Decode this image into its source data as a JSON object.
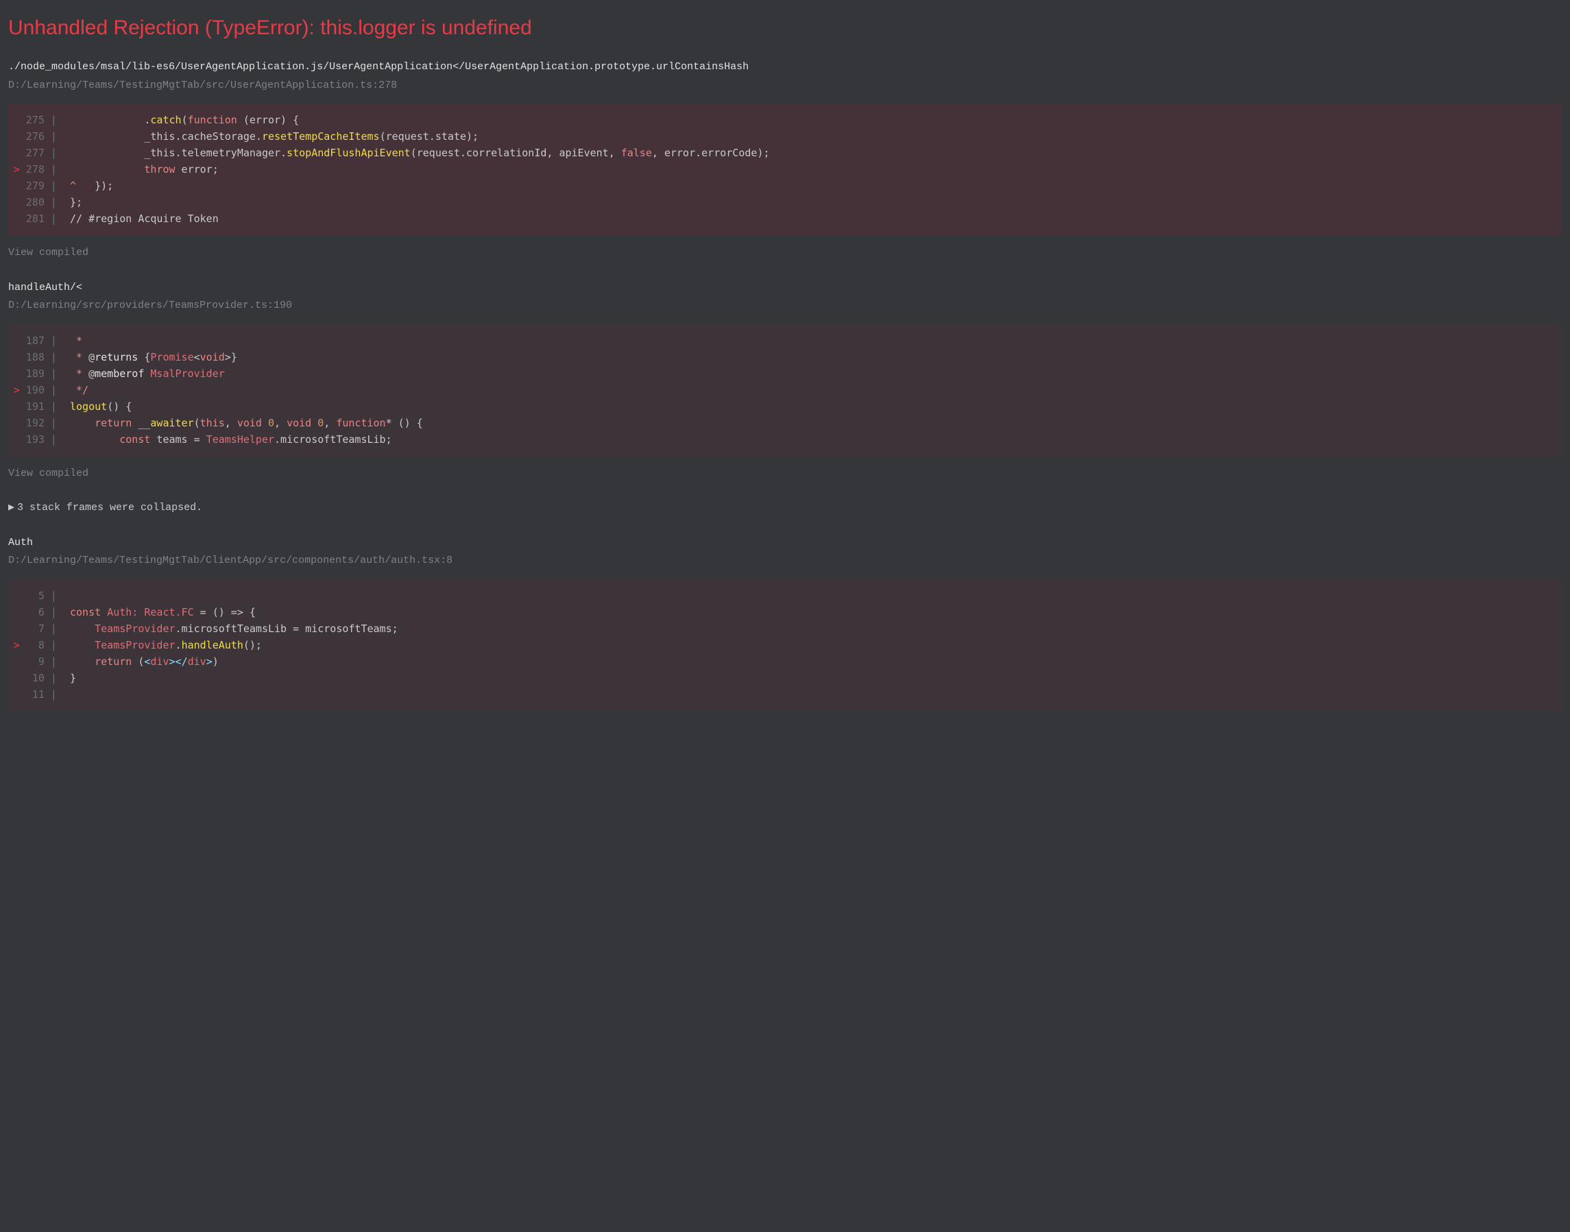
{
  "error_title": "Unhandled Rejection (TypeError): this.logger is undefined",
  "view_compiled_label": "View compiled",
  "collapsed_label": "3 stack frames were collapsed.",
  "collapsed_icon": "▶",
  "frames": [
    {
      "title": "./node_modules/msal/lib-es6/UserAgentApplication.js/UserAgentApplication</UserAgentApplication.prototype.urlContainsHash",
      "file": "D:/Learning/Teams/TestingMgtTab/src/UserAgentApplication.ts:278",
      "highlight_red": true,
      "current_line": 278,
      "lines": [
        {
          "n": 275,
          "tokens": [
            {
              "t": "            .",
              "c": "text"
            },
            {
              "t": "catch",
              "c": "yellow"
            },
            {
              "t": "(",
              "c": "text"
            },
            {
              "t": "function",
              "c": "red"
            },
            {
              "t": " (error) {",
              "c": "text"
            }
          ]
        },
        {
          "n": 276,
          "tokens": [
            {
              "t": "            _this.cacheStorage.",
              "c": "text"
            },
            {
              "t": "resetTempCacheItems",
              "c": "yellow"
            },
            {
              "t": "(request.state);",
              "c": "text"
            }
          ]
        },
        {
          "n": 277,
          "tokens": [
            {
              "t": "            _this.telemetryManager.",
              "c": "text"
            },
            {
              "t": "stopAndFlushApiEvent",
              "c": "yellow"
            },
            {
              "t": "(request.correlationId, apiEvent, ",
              "c": "text"
            },
            {
              "t": "false",
              "c": "red"
            },
            {
              "t": ", error.errorCode);",
              "c": "text"
            }
          ]
        },
        {
          "n": 278,
          "tokens": [
            {
              "t": "            ",
              "c": "text"
            },
            {
              "t": "throw",
              "c": "red"
            },
            {
              "t": " error;",
              "c": "text"
            }
          ]
        },
        {
          "n": 279,
          "tokens": [
            {
              "t": "^",
              "c": "red"
            },
            {
              "t": "   });",
              "c": "text"
            }
          ]
        },
        {
          "n": 280,
          "tokens": [
            {
              "t": "};",
              "c": "text"
            }
          ]
        },
        {
          "n": 281,
          "tokens": [
            {
              "t": "// #region Acquire Token",
              "c": "text"
            }
          ]
        }
      ]
    },
    {
      "title": "handleAuth/<",
      "file": "D:/Learning/src/providers/TeamsProvider.ts:190",
      "highlight_red": false,
      "current_line": 190,
      "lines": [
        {
          "n": 187,
          "tokens": [
            {
              "t": " *",
              "c": "red"
            }
          ]
        },
        {
          "n": 188,
          "tokens": [
            {
              "t": " * ",
              "c": "red"
            },
            {
              "t": "@",
              "c": "text"
            },
            {
              "t": "returns",
              "c": "white"
            },
            {
              "t": " {",
              "c": "text"
            },
            {
              "t": "Promise",
              "c": "red2"
            },
            {
              "t": "<",
              "c": "text"
            },
            {
              "t": "void",
              "c": "red"
            },
            {
              "t": ">",
              "c": "text"
            },
            {
              "t": "}",
              "c": "text"
            }
          ]
        },
        {
          "n": 189,
          "tokens": [
            {
              "t": " * ",
              "c": "red"
            },
            {
              "t": "@",
              "c": "text"
            },
            {
              "t": "memberof",
              "c": "white"
            },
            {
              "t": " ",
              "c": "text"
            },
            {
              "t": "MsalProvider",
              "c": "red2"
            }
          ]
        },
        {
          "n": 190,
          "tokens": [
            {
              "t": " */",
              "c": "red"
            }
          ]
        },
        {
          "n": 191,
          "tokens": [
            {
              "t": "logout",
              "c": "yellow"
            },
            {
              "t": "() {",
              "c": "text"
            }
          ]
        },
        {
          "n": 192,
          "tokens": [
            {
              "t": "    ",
              "c": "text"
            },
            {
              "t": "return",
              "c": "red"
            },
            {
              "t": " ",
              "c": "text"
            },
            {
              "t": "__awaiter",
              "c": "yellow"
            },
            {
              "t": "(",
              "c": "text"
            },
            {
              "t": "this",
              "c": "red"
            },
            {
              "t": ", ",
              "c": "text"
            },
            {
              "t": "void",
              "c": "red"
            },
            {
              "t": " ",
              "c": "text"
            },
            {
              "t": "0",
              "c": "orange"
            },
            {
              "t": ", ",
              "c": "text"
            },
            {
              "t": "void",
              "c": "red"
            },
            {
              "t": " ",
              "c": "text"
            },
            {
              "t": "0",
              "c": "orange"
            },
            {
              "t": ", ",
              "c": "text"
            },
            {
              "t": "function",
              "c": "red"
            },
            {
              "t": "* () {",
              "c": "text"
            }
          ]
        },
        {
          "n": 193,
          "tokens": [
            {
              "t": "        ",
              "c": "text"
            },
            {
              "t": "const",
              "c": "red"
            },
            {
              "t": " teams = ",
              "c": "text"
            },
            {
              "t": "TeamsHelper",
              "c": "red2"
            },
            {
              "t": ".microsoftTeamsLib;",
              "c": "text"
            }
          ]
        }
      ]
    },
    {
      "title": "Auth",
      "file": "D:/Learning/Teams/TestingMgtTab/ClientApp/src/components/auth/auth.tsx:8",
      "highlight_red": false,
      "current_line": 8,
      "lines": [
        {
          "n": 5,
          "tokens": []
        },
        {
          "n": 6,
          "tokens": [
            {
              "t": "const",
              "c": "red"
            },
            {
              "t": " ",
              "c": "text"
            },
            {
              "t": "Auth: React.FC",
              "c": "red2"
            },
            {
              "t": " = () => {",
              "c": "text"
            }
          ]
        },
        {
          "n": 7,
          "tokens": [
            {
              "t": "    ",
              "c": "text"
            },
            {
              "t": "TeamsProvider",
              "c": "red2"
            },
            {
              "t": ".microsoftTeamsLib = microsoftTeams;",
              "c": "text"
            }
          ]
        },
        {
          "n": 8,
          "tokens": [
            {
              "t": "    ",
              "c": "text"
            },
            {
              "t": "TeamsProvider",
              "c": "red2"
            },
            {
              "t": ".",
              "c": "text"
            },
            {
              "t": "handleAuth",
              "c": "yellow"
            },
            {
              "t": "();",
              "c": "text"
            }
          ]
        },
        {
          "n": 9,
          "tokens": [
            {
              "t": "    ",
              "c": "text"
            },
            {
              "t": "return",
              "c": "red"
            },
            {
              "t": " (",
              "c": "text"
            },
            {
              "t": "<",
              "c": "blue"
            },
            {
              "t": "div",
              "c": "red2"
            },
            {
              "t": ">",
              "c": "blue"
            },
            {
              "t": "<",
              "c": "blue"
            },
            {
              "t": "/",
              "c": "blue"
            },
            {
              "t": "div",
              "c": "red2"
            },
            {
              "t": ">",
              "c": "blue"
            },
            {
              "t": ")",
              "c": "text"
            }
          ]
        },
        {
          "n": 10,
          "tokens": [
            {
              "t": "}",
              "c": "text"
            }
          ]
        },
        {
          "n": 11,
          "tokens": []
        }
      ]
    }
  ]
}
